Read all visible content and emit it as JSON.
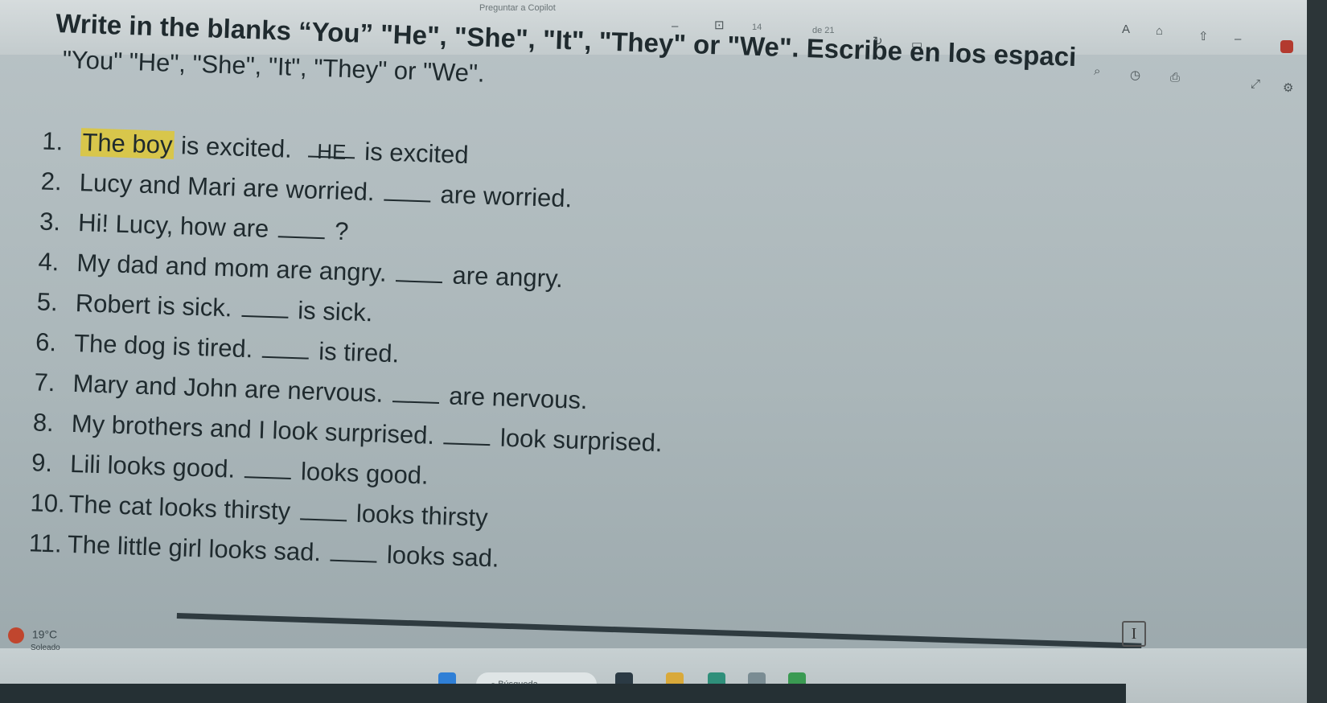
{
  "window": {
    "title_fragment": "Preguntar a Copilot",
    "toolbar_text_1": "14",
    "toolbar_text_2": "de 21"
  },
  "worksheet": {
    "title": "Write in the blanks “You” \"He\", \"She\", \"It\", \"They\" or \"We\". Escribe en los espaci",
    "subtitle": "\"You\" \"He\", \"She\", \"It\", \"They\" or \"We\".",
    "items": [
      {
        "num": "1.",
        "pre": "The boy",
        "mid": "is excited.",
        "answer": "HE",
        "post": "is excited"
      },
      {
        "num": "2.",
        "pre": "Lucy and Mari are worried.",
        "answer": "",
        "post": "are worried."
      },
      {
        "num": "3.",
        "pre": "Hi! Lucy, how are",
        "answer": "",
        "post": "?"
      },
      {
        "num": "4.",
        "pre": "My dad and mom are angry.",
        "answer": "",
        "post": "are angry."
      },
      {
        "num": "5.",
        "pre": "Robert is sick.",
        "answer": "",
        "post": "is sick."
      },
      {
        "num": "6.",
        "pre": "The dog is tired.",
        "answer": "",
        "post": "is tired."
      },
      {
        "num": "7.",
        "pre": "Mary and John are nervous.",
        "answer": "",
        "post": "are nervous."
      },
      {
        "num": "8.",
        "pre": "My brothers and I look surprised.",
        "answer": "",
        "post": "look surprised."
      },
      {
        "num": "9.",
        "pre": "Lili looks good.",
        "answer": "",
        "post": "looks good."
      },
      {
        "num": "10.",
        "pre": "The cat looks thirsty",
        "answer": "",
        "post": "looks thirsty"
      },
      {
        "num": "11.",
        "pre": "The little girl looks sad.",
        "answer": "",
        "post": "looks sad."
      }
    ]
  },
  "taskbar": {
    "weather_temp": "19°C",
    "weather_desc": "Soleado",
    "search_placeholder": "Búsqueda"
  },
  "colors": {
    "highlight": "#d8c64b",
    "ink": "#1f2a2e",
    "screen_bg": "#aab6b9"
  }
}
